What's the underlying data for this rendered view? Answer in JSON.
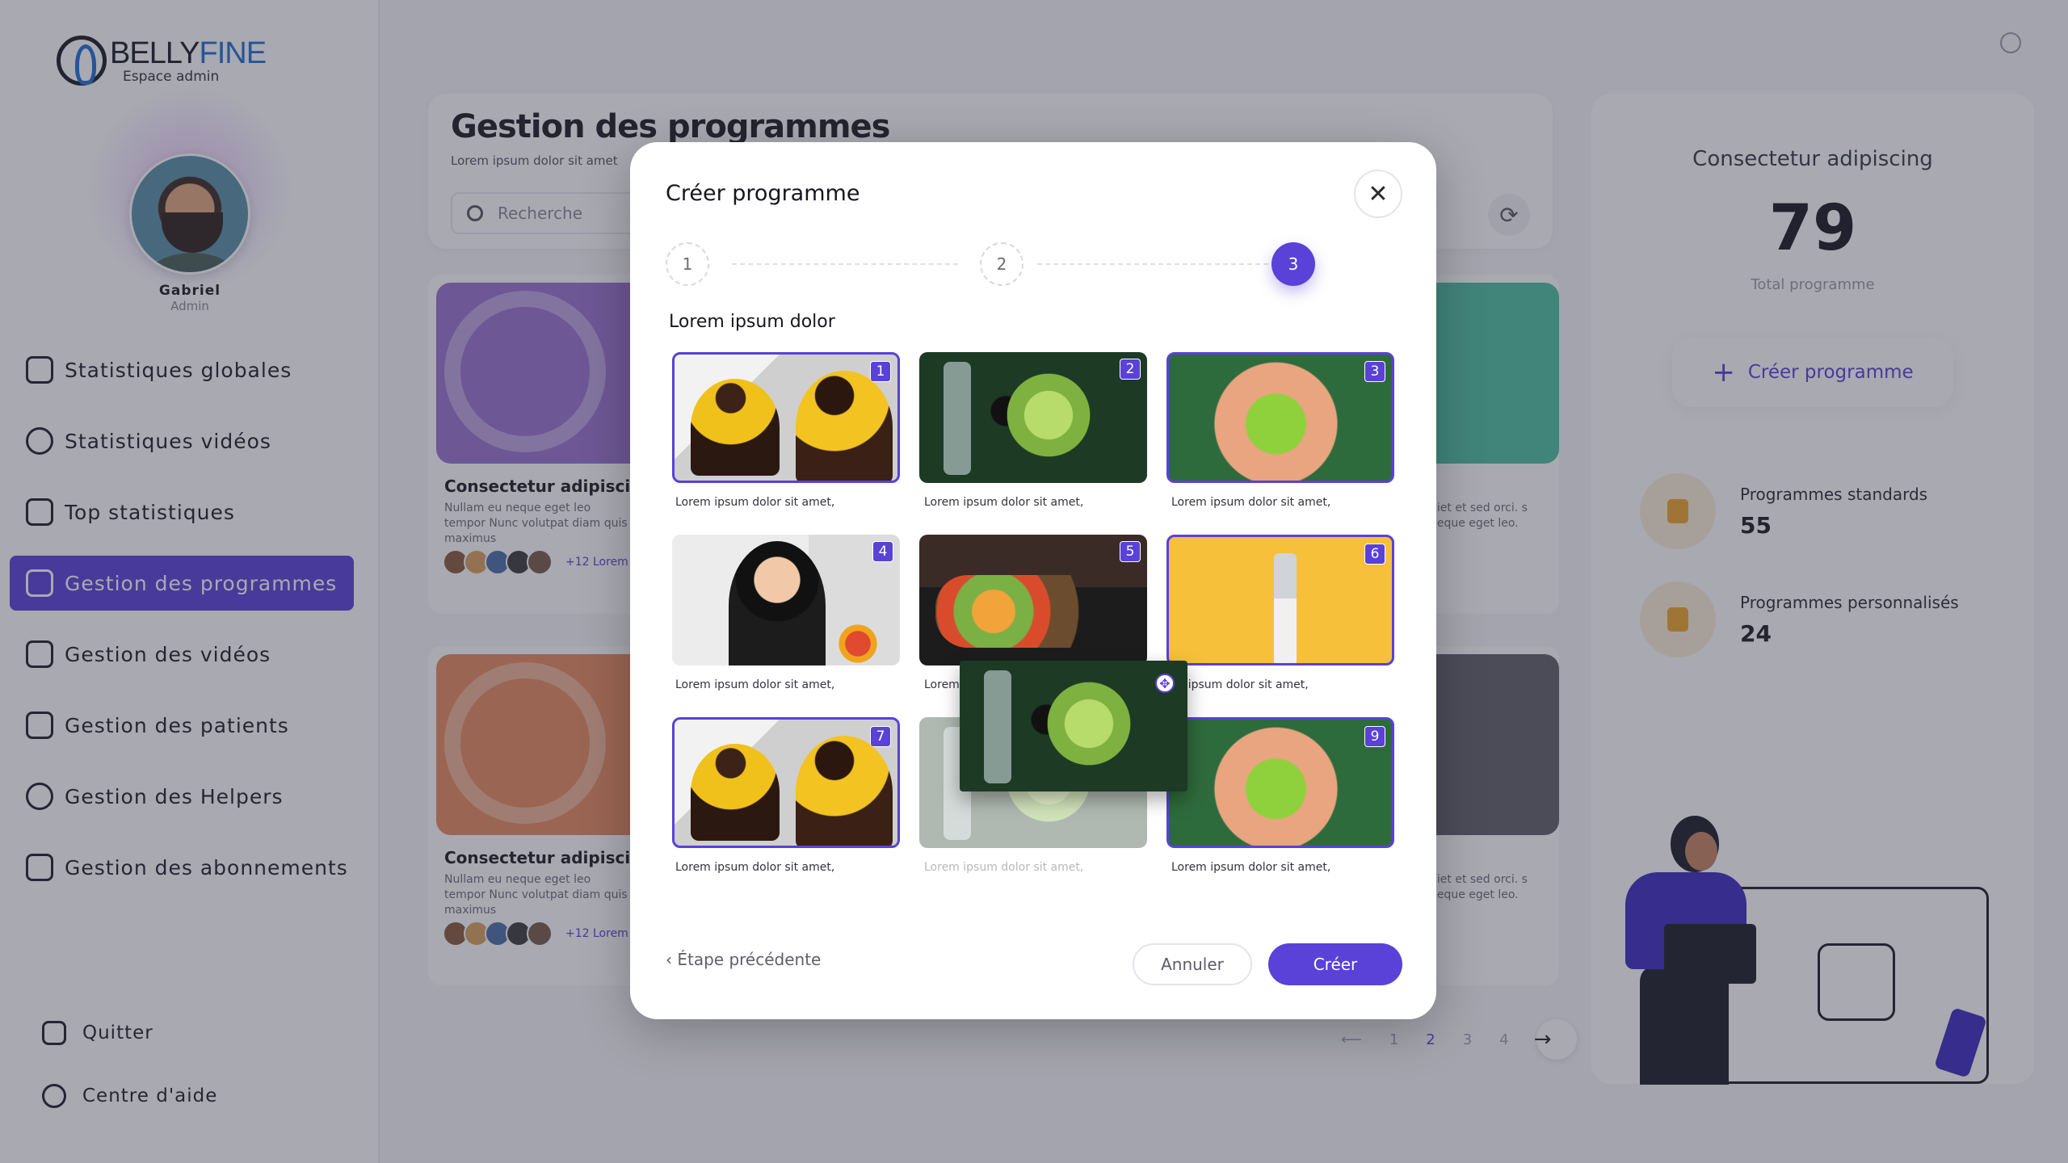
{
  "brand": {
    "name_part1": "BELLY",
    "name_part2": "FINE",
    "subtitle": "Espace admin"
  },
  "user": {
    "name": "Gabriel",
    "role": "Admin"
  },
  "sidebar": {
    "items": [
      {
        "label": "Statistiques globales",
        "icon": "monitor-chart-icon"
      },
      {
        "label": "Statistiques vidéos",
        "icon": "pie-chart-icon"
      },
      {
        "label": "Top statistiques",
        "icon": "bar-chart-icon"
      },
      {
        "label": "Gestion des programmes",
        "icon": "programs-icon",
        "active": true
      },
      {
        "label": "Gestion des vidéos",
        "icon": "video-icon"
      },
      {
        "label": "Gestion des patients",
        "icon": "patient-icon"
      },
      {
        "label": "Gestion des Helpers",
        "icon": "stethoscope-icon"
      },
      {
        "label": "Gestion des abonnements",
        "icon": "subscription-icon"
      }
    ],
    "quit": "Quitter",
    "help": "Centre d'aide"
  },
  "header": {
    "title": "Gestion des programmes",
    "subtitle": "Lorem ipsum dolor sit amet",
    "search_placeholder": "Recherche"
  },
  "programs": [
    {
      "title": "Consectetur adipiscing e",
      "desc": "Nullam eu neque eget leo tempor Nunc volutpat diam quis maximus",
      "desc_right": "diet et sed orci. s neque eget leo.",
      "more": "+12 Lorem",
      "color": "#9a73cf"
    },
    {
      "title": "Consectetur adipiscing e",
      "desc": "Nullam eu neque eget leo tempor Nunc volutpat diam quis maximus",
      "desc_right": "diet et sed orci. s neque eget leo.",
      "more": "+12 Lorem",
      "color": "#e98b5d"
    }
  ],
  "pagination": {
    "pages": [
      "1",
      "2",
      "3",
      "4"
    ],
    "current": "2"
  },
  "right_panel": {
    "title": "Consectetur adipiscing",
    "total": "79",
    "total_label": "Total programme",
    "create_label": "Créer programme",
    "stats": [
      {
        "label": "Programmes standards",
        "value": "55"
      },
      {
        "label": "Programmes personnalisés",
        "value": "24"
      }
    ]
  },
  "modal": {
    "title": "Créer programme",
    "steps": [
      "1",
      "2",
      "3"
    ],
    "active_step": "3",
    "section_label": "Lorem ipsum dolor",
    "tiles": [
      {
        "badge": "1",
        "caption": "Lorem ipsum dolor sit amet,",
        "photo": "fitness",
        "selected": true
      },
      {
        "badge": "2",
        "caption": "Lorem ipsum dolor sit amet,",
        "photo": "vegetables",
        "selected": false
      },
      {
        "badge": "3",
        "caption": "Lorem ipsum dolor sit amet,",
        "photo": "apple",
        "selected": true
      },
      {
        "badge": "4",
        "caption": "Lorem ipsum dolor sit amet,",
        "photo": "woman",
        "selected": false
      },
      {
        "badge": "5",
        "caption": "Lorem",
        "photo": "waist",
        "selected": false
      },
      {
        "badge": "6",
        "caption": "em ipsum dolor sit amet,",
        "photo": "measuring-tape",
        "selected": true
      },
      {
        "badge": "7",
        "caption": "Lorem ipsum dolor sit amet,",
        "photo": "fitness",
        "selected": true
      },
      {
        "badge": "",
        "caption": "Lorem ipsum dolor sit amet,",
        "photo": "vegetables",
        "selected": false,
        "ghost": true
      },
      {
        "badge": "9",
        "caption": "Lorem ipsum dolor sit amet,",
        "photo": "apple",
        "selected": true
      }
    ],
    "dragging_photo": "vegetables",
    "prev_label": "Étape précédente",
    "cancel_label": "Annuler",
    "create_label": "Créer"
  }
}
